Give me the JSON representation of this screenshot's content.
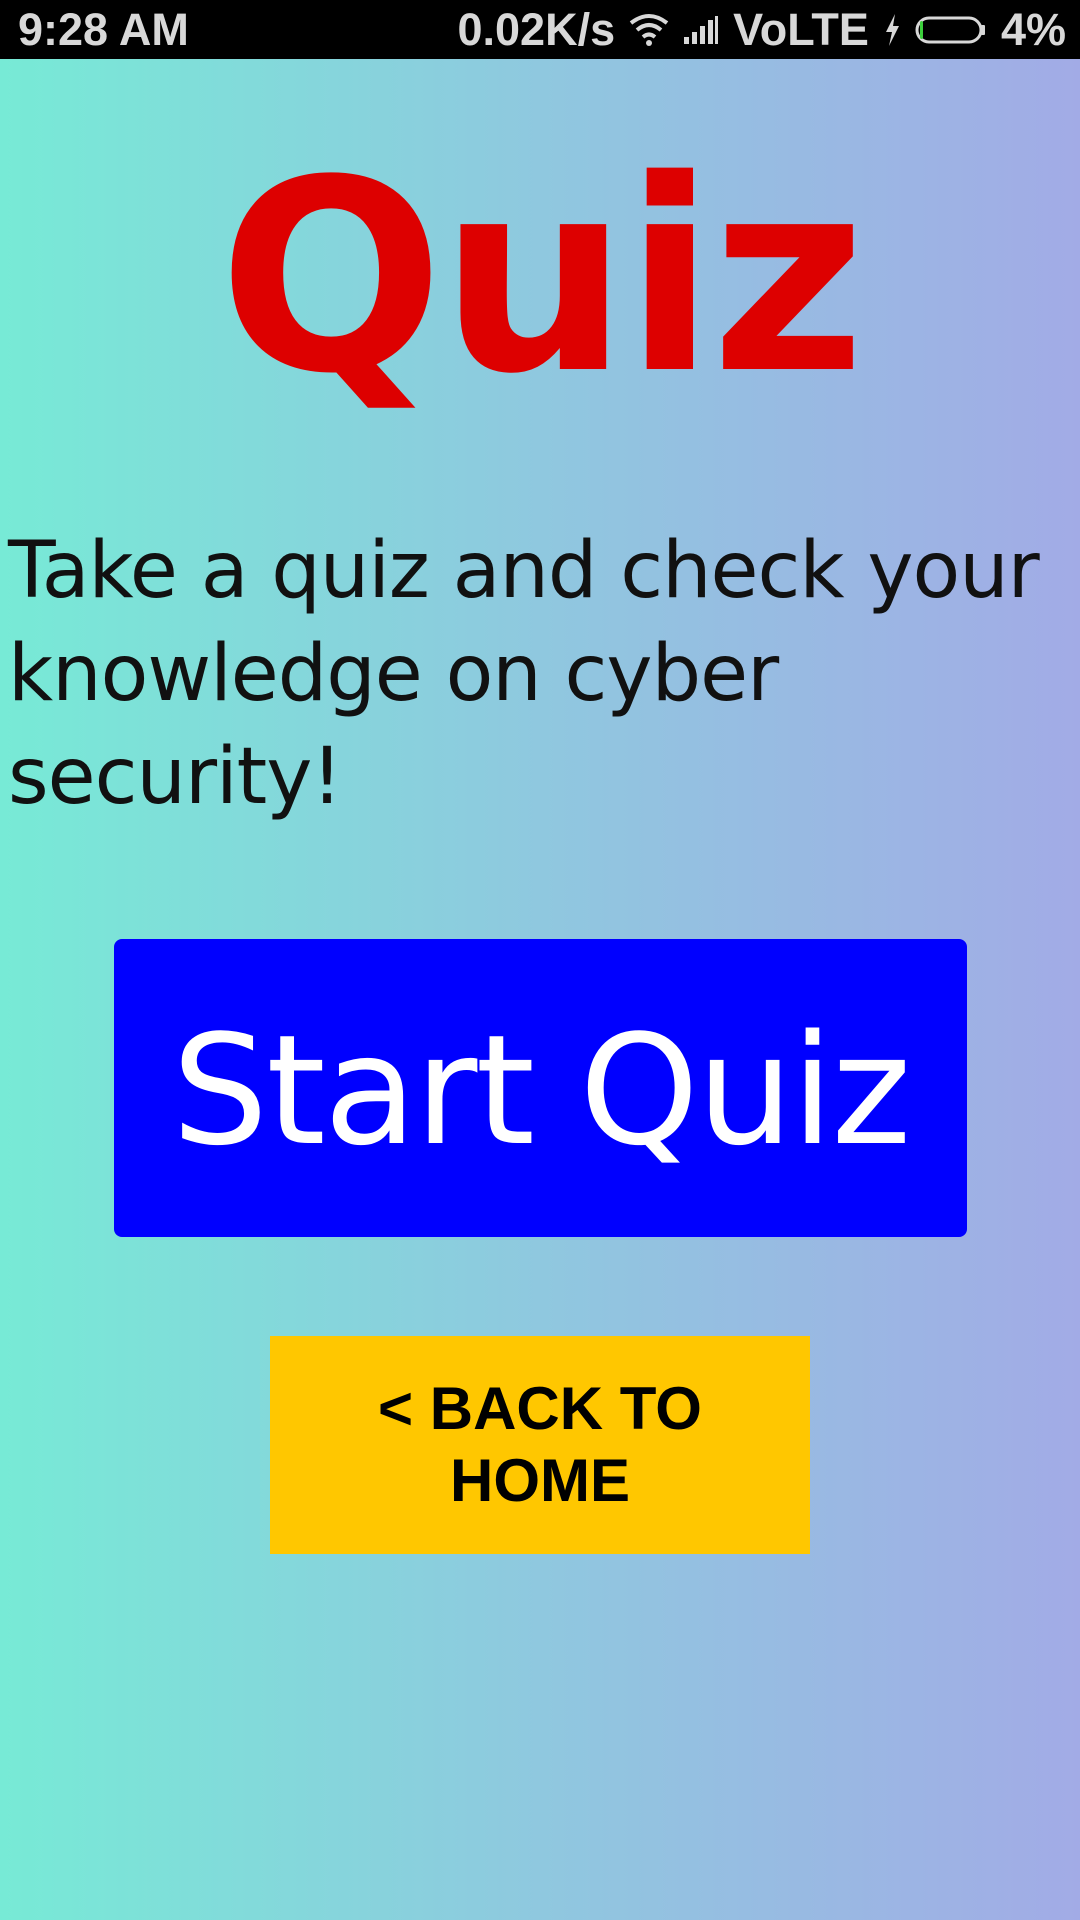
{
  "status_bar": {
    "time": "9:28 AM",
    "network_speed": "0.02K/s",
    "network_type": "VoLTE",
    "battery_percent": "4%",
    "battery_level": 0.04,
    "icons": [
      "wifi-icon",
      "signal-icon",
      "charging-icon",
      "battery-icon"
    ]
  },
  "title": "Quiz",
  "description": "Take a quiz and check your knowledge on cyber security!",
  "start_button": {
    "label": "Start Quiz"
  },
  "back_button": {
    "line1": "< BACK TO",
    "line2": "HOME"
  },
  "colors": {
    "title": "#DD0000",
    "start_button_bg": "#0000FF",
    "back_button_bg": "#FFC700",
    "gradient_left": "#77EAD6",
    "gradient_right": "#A2ABE6"
  }
}
